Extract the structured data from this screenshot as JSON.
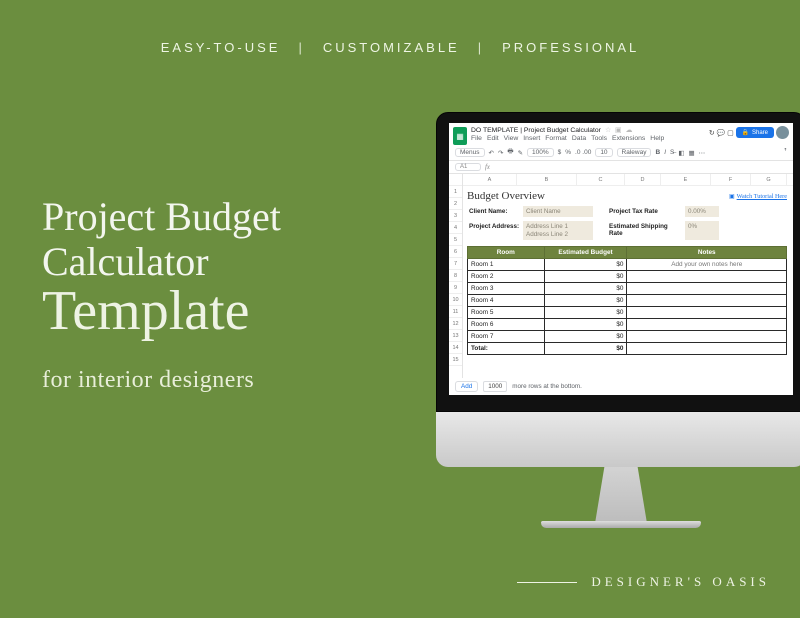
{
  "taglines": {
    "t1": "EASY-TO-USE",
    "t2": "CUSTOMIZABLE",
    "t3": "PROFESSIONAL",
    "sep": "|"
  },
  "headline": {
    "line1": "Project Budget",
    "line2": "Calculator",
    "script": "Template",
    "sub": "for interior designers"
  },
  "brand": "DESIGNER'S OASIS",
  "sheets": {
    "docTitle": "DO TEMPLATE | Project Budget Calculator",
    "menus": [
      "File",
      "Edit",
      "View",
      "Insert",
      "Format",
      "Data",
      "Tools",
      "Extensions",
      "Help"
    ],
    "toolbar": {
      "menus_label": "Menus",
      "zoom": "100%",
      "currency": "$",
      "percent": "%",
      "decimals": ".0 .00",
      "fontsize": "10",
      "font": "Raleway"
    },
    "cellRef": "A1",
    "colHeaders": [
      "A",
      "B",
      "C",
      "D",
      "E",
      "F",
      "G"
    ],
    "rowHeaders": [
      "",
      "1",
      "2",
      "3",
      "4",
      "5",
      "6",
      "7",
      "8",
      "9",
      "10",
      "11",
      "12",
      "13",
      "14",
      "15"
    ],
    "overview": {
      "title": "Budget Overview",
      "watchLink": "Watch Tutorial Here",
      "clientNameLabel": "Client Name:",
      "clientNameVal": "Client Name",
      "taxRateLabel": "Project Tax Rate",
      "taxRateVal": "0.00%",
      "addressLabel": "Project Address:",
      "addressVal1": "Address Line 1",
      "addressVal2": "Address Line 2",
      "shipLabel": "Estimated Shipping Rate",
      "shipVal": "0%"
    },
    "table": {
      "headers": [
        "Room",
        "Estimated Budget",
        "Notes"
      ],
      "rows": [
        {
          "room": "Room 1",
          "budget": "$0",
          "note": "Add your own notes here"
        },
        {
          "room": "Room 2",
          "budget": "$0",
          "note": ""
        },
        {
          "room": "Room 3",
          "budget": "$0",
          "note": ""
        },
        {
          "room": "Room 4",
          "budget": "$0",
          "note": ""
        },
        {
          "room": "Room 5",
          "budget": "$0",
          "note": ""
        },
        {
          "room": "Room 6",
          "budget": "$0",
          "note": ""
        },
        {
          "room": "Room 7",
          "budget": "$0",
          "note": ""
        }
      ],
      "totalLabel": "Total:",
      "totalVal": "$0"
    },
    "footer": {
      "add": "Add",
      "count": "1000",
      "tail": "more rows at the bottom."
    }
  }
}
